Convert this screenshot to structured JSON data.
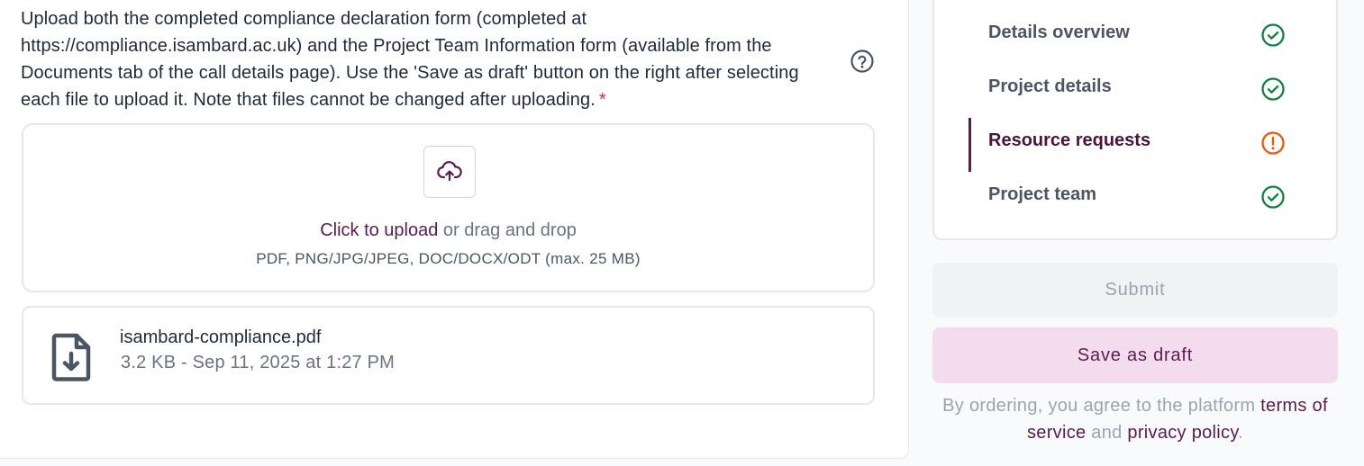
{
  "upload_section": {
    "instructions": "Upload both the completed compliance declaration form (completed at https://compliance.isambard.ac.uk) and the Project Team Information form (available from the Documents tab of the call details page). Use the 'Save as draft' button on the right after selecting each file to upload it. Note that files cannot be changed after uploading.",
    "required_marker": "*",
    "help_icon": "question-circle-icon",
    "dropzone": {
      "upload_icon": "cloud-upload-icon",
      "click_text": "Click to upload",
      "drag_text": " or drag and drop",
      "file_types": "PDF, PNG/JPG/JPEG, DOC/DOCX/ODT (max. 25 MB)"
    },
    "uploaded_file": {
      "icon": "file-download-icon",
      "name": "isambard-compliance.pdf",
      "meta": "3.2 KB - Sep 11, 2025 at 1:27 PM"
    }
  },
  "sidebar": {
    "steps": [
      {
        "label": "Details overview",
        "status": "complete"
      },
      {
        "label": "Project details",
        "status": "complete"
      },
      {
        "label": "Resource requests",
        "status": "warning",
        "active": true
      },
      {
        "label": "Project team",
        "status": "complete"
      }
    ],
    "submit_label": "Submit",
    "draft_label": "Save as draft",
    "terms": {
      "prefix": "By ordering, you agree to the platform ",
      "terms_link": "terms of service",
      "middle": " and ",
      "privacy_link": "privacy policy",
      "suffix": "."
    }
  },
  "colors": {
    "brand": "#581c4e",
    "success": "#15803d",
    "warning": "#ea580c",
    "required": "#dc2626"
  }
}
